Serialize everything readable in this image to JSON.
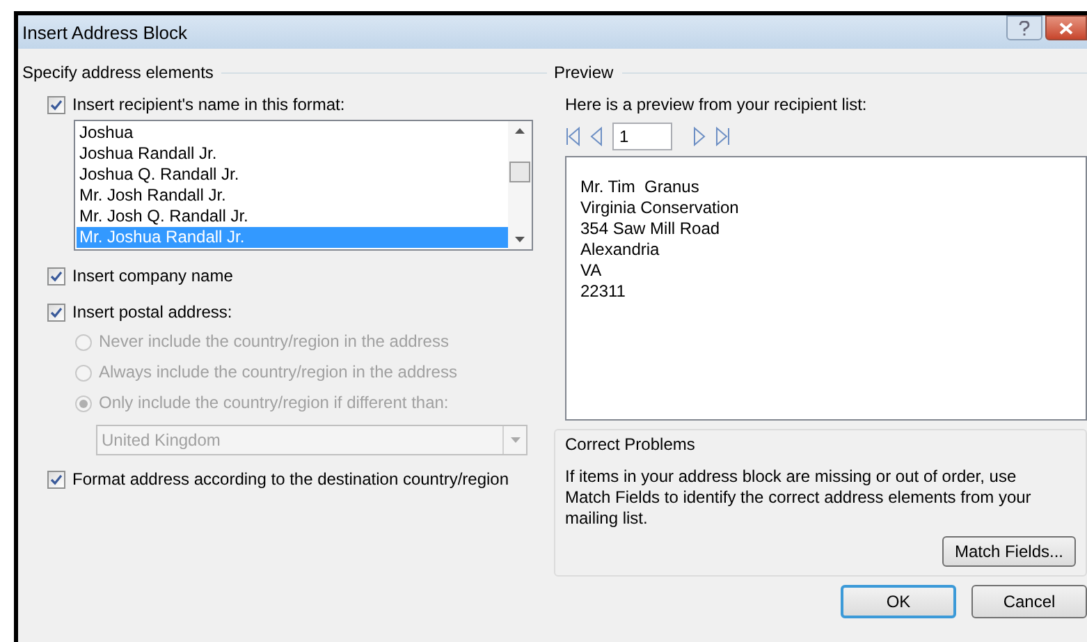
{
  "window": {
    "title": "Insert Address Block"
  },
  "address_elements": {
    "title": "Specify address elements",
    "name_format": {
      "label": "Insert recipient's name in this format:",
      "checked": true
    },
    "name_list": [
      {
        "label": "Joshua",
        "selected": false
      },
      {
        "label": "Joshua Randall Jr.",
        "selected": false
      },
      {
        "label": "Joshua Q. Randall Jr.",
        "selected": false
      },
      {
        "label": "Mr. Josh Randall Jr.",
        "selected": false
      },
      {
        "label": "Mr. Josh Q. Randall Jr.",
        "selected": false
      },
      {
        "label": "Mr. Joshua Randall Jr.",
        "selected": true
      }
    ],
    "company": {
      "label": "Insert company name",
      "checked": true
    },
    "postal": {
      "label": "Insert postal address:",
      "checked": true
    },
    "country_options": [
      {
        "label": "Never include the country/region in the address",
        "selected": false,
        "disabled": true
      },
      {
        "label": "Always include the country/region in the address",
        "selected": false,
        "disabled": true
      },
      {
        "label": "Only include the country/region if different than:",
        "selected": true,
        "disabled": true
      }
    ],
    "country": {
      "value": "United Kingdom",
      "disabled": true
    },
    "format_by_country": {
      "label": "Format address according to the destination country/region",
      "checked": true
    }
  },
  "preview": {
    "title": "Preview",
    "hint": "Here is a preview from your recipient list:",
    "record": "1",
    "lines": [
      "Mr. Tim  Granus",
      "Virginia Conservation",
      "354 Saw Mill Road",
      "Alexandria",
      "VA",
      "22311"
    ]
  },
  "correct_problems": {
    "title": "Correct Problems",
    "text": "If items in your address block are missing or out of order, use Match Fields to identify the correct address elements from your mailing list.",
    "button": "Match Fields..."
  },
  "buttons": [
    {
      "label": "OK",
      "default": true
    },
    {
      "label": "Cancel",
      "default": false
    }
  ]
}
